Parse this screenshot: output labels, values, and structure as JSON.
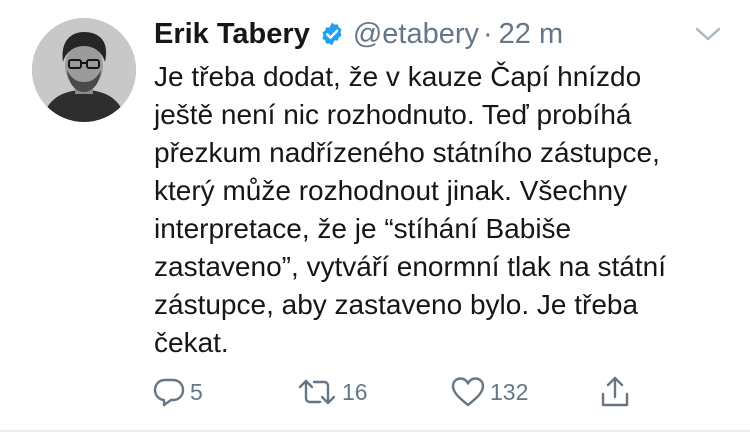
{
  "tweet": {
    "author": {
      "name": "Erik Tabery",
      "handle": "@etabery",
      "time": "22 m",
      "verified": true
    },
    "separator": "·",
    "text_lines": [
      "Je třeba dodat, že v kauze Čapí hnízdo",
      "ještě není nic rozhodnuto. Teď probíhá",
      "přezkum nadřízeného státního zástupce,",
      "který může rozhodnout jinak. Všechny",
      "interpretace, že je “stíhání Babiše",
      "zastaveno”, vytváří enormní tlak na státní",
      "zástupce, aby zastaveno bylo. Je třeba",
      "čekat."
    ],
    "actions": {
      "reply_count": "5",
      "retweet_count": "16",
      "like_count": "132"
    },
    "icons": {
      "verified": "verified-badge-icon",
      "menu": "chevron-down-icon",
      "reply": "reply-icon",
      "retweet": "retweet-icon",
      "like": "heart-icon",
      "share": "share-icon"
    },
    "colors": {
      "text": "#14171a",
      "secondary": "#657786",
      "verified_blue": "#1da1f2",
      "background": "#ffffff"
    }
  }
}
